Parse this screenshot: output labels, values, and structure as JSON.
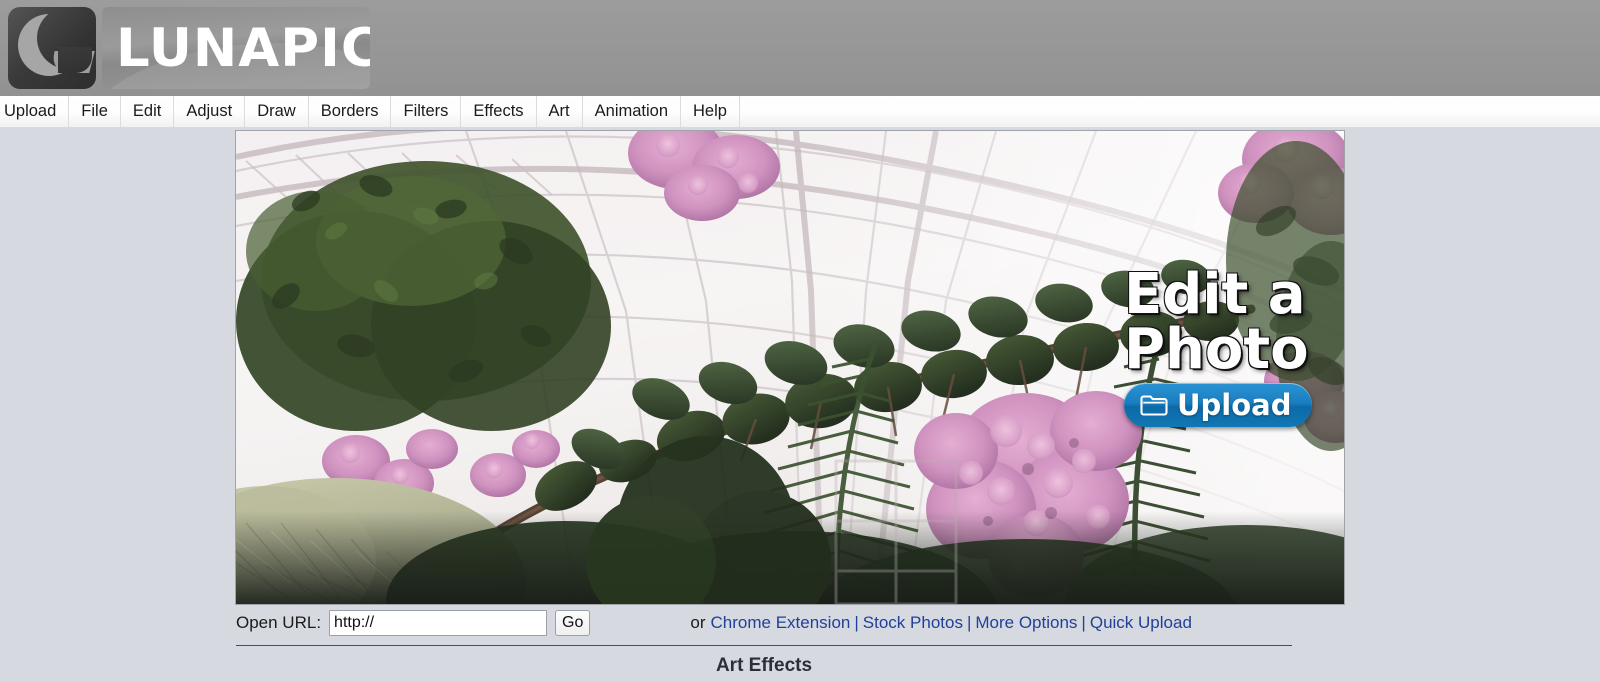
{
  "header": {
    "logo_text": "LUNAPIC",
    "logo_mark_name": "crescent-moon-logo"
  },
  "menubar": {
    "items": [
      {
        "label": "Upload"
      },
      {
        "label": "File"
      },
      {
        "label": "Edit"
      },
      {
        "label": "Adjust"
      },
      {
        "label": "Draw"
      },
      {
        "label": "Borders"
      },
      {
        "label": "Filters"
      },
      {
        "label": "Effects"
      },
      {
        "label": "Art"
      },
      {
        "label": "Animation"
      },
      {
        "label": "Help"
      }
    ]
  },
  "canvas": {
    "photo_alt": "Greenhouse conservatory with crape myrtle blossoms",
    "overlay_title": "Edit a Photo",
    "upload_button_label": "Upload",
    "upload_icon": "folder-icon"
  },
  "toolbar": {
    "url_label": "Open URL:",
    "url_value": "http://",
    "url_placeholder": "http://",
    "go_label": "Go",
    "or_text": "or",
    "separator": "|",
    "links": [
      {
        "label": "Chrome Extension"
      },
      {
        "label": "Stock Photos"
      },
      {
        "label": "More Options"
      },
      {
        "label": "Quick Upload"
      }
    ]
  },
  "below_fold": {
    "section_title": "Art Effects"
  },
  "colors": {
    "header_gray": "#969696",
    "page_background": "#d6dae0",
    "link_blue": "#21409a",
    "upload_button_blue": "#1a7fc0",
    "menu_text": "#1b1b1b"
  }
}
